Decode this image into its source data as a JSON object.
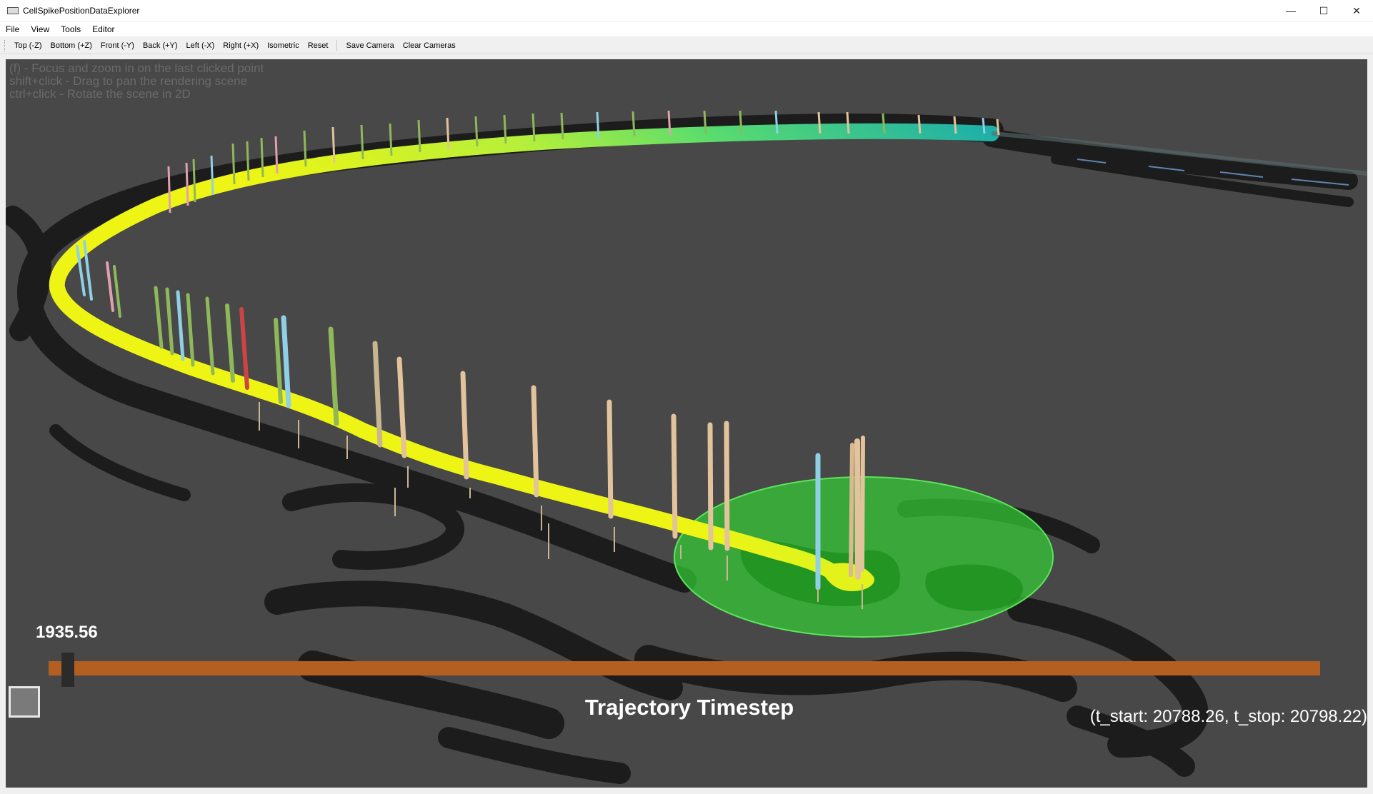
{
  "window": {
    "title": "CellSpikePositionDataExplorer",
    "controls": {
      "minimize": "—",
      "maximize": "☐",
      "close": "✕"
    }
  },
  "menu": {
    "items": [
      "File",
      "View",
      "Tools",
      "Editor"
    ]
  },
  "toolbar": {
    "camera_buttons": [
      "Top (-Z)",
      "Bottom (+Z)",
      "Front (-Y)",
      "Back (+Y)",
      "Left (-X)",
      "Right (+X)",
      "Isometric",
      "Reset"
    ],
    "save_camera": "Save Camera",
    "clear_cameras": "Clear Cameras"
  },
  "viewport": {
    "background": "#484848",
    "hints": [
      "(f) - Focus and zoom in on the last clicked point",
      "shift+click - Drag to pan the rendering scene",
      "ctrl+click - Rotate the scene in 2D"
    ],
    "colors": {
      "trajectory_near": "#e6f21a",
      "trajectory_far": "#3cc98a",
      "placefield_disc": "#33cc33",
      "spike_tan": "#e2c39b",
      "spike_blue": "#8fd0e6",
      "shadow": "#1c1c1c"
    }
  },
  "slider": {
    "value": "1935.56",
    "title": "Trajectory Timestep",
    "time_range": "(t_start: 20788.26, t_stop: 20798.22)",
    "track_color": "#b35f22"
  }
}
